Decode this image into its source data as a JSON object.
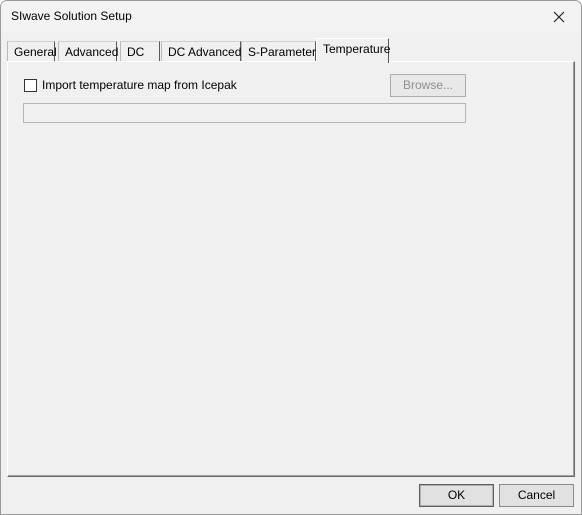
{
  "window": {
    "title": "SIwave Solution Setup"
  },
  "tabs": [
    {
      "label": "General"
    },
    {
      "label": "Advanced"
    },
    {
      "label": "DC"
    },
    {
      "label": "DC Advanced"
    },
    {
      "label": "S-Parameters"
    },
    {
      "label": "Temperature",
      "active": true
    }
  ],
  "temperature": {
    "import_checkbox_label": "Import temperature map from Icepak",
    "import_checked": false,
    "browse_label": "Browse...",
    "path_value": ""
  },
  "footer": {
    "ok_label": "OK",
    "cancel_label": "Cancel"
  }
}
